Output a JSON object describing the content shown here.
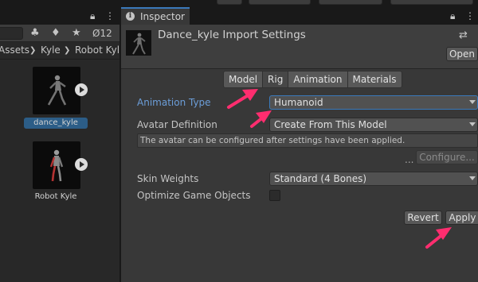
{
  "project_panel": {
    "hidden_count": "12",
    "breadcrumb": [
      "Assets",
      "Kyle",
      "Robot Kyle"
    ],
    "assets": [
      {
        "label": "dance_kyle",
        "selected": true
      },
      {
        "label": "Robot Kyle",
        "selected": false
      }
    ]
  },
  "inspector": {
    "tab_label": "Inspector",
    "title": "Dance_kyle Import Settings",
    "open_label": "Open",
    "tabs": [
      "Model",
      "Rig",
      "Animation",
      "Materials"
    ],
    "active_tab": "Rig",
    "animation_type": {
      "label": "Animation Type",
      "value": "Humanoid"
    },
    "avatar_definition": {
      "label": "Avatar Definition",
      "value": "Create From This Model"
    },
    "help_text": "The avatar can be configured after settings have been applied.",
    "ellipsis": "...",
    "configure_label": "Configure...",
    "skin_weights": {
      "label": "Skin Weights",
      "value": "Standard (4 Bones)"
    },
    "optimize_game_objects": {
      "label": "Optimize Game Objects",
      "checked": false
    },
    "revert_label": "Revert",
    "apply_label": "Apply"
  },
  "colors": {
    "accent_blue": "#3a79bb",
    "label_blue": "#6c9ed9",
    "annotation_arrow": "#ff2d6f"
  }
}
